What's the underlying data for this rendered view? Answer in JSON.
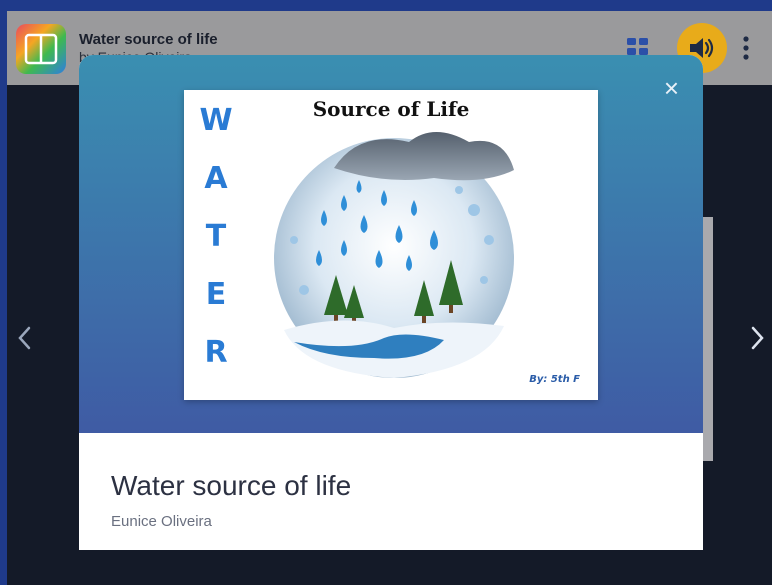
{
  "header": {
    "book_title": "Water source of life",
    "book_author": "by Eunice Oliveira"
  },
  "modal": {
    "close_label": "×",
    "title": "Water source of life",
    "author": "Eunice Oliveira"
  },
  "cover": {
    "vertical_word": [
      "W",
      "A",
      "T",
      "E",
      "R"
    ],
    "heading": "Source of Life",
    "credit": "By: 5th F"
  },
  "navigation": {
    "prev_label": "‹",
    "next_label": "›"
  },
  "icons": {
    "app": "book-creator-app-icon",
    "layout": "grid-view-icon",
    "sound": "speaker-icon",
    "menu": "more-vertical-icon"
  },
  "colors": {
    "frame": "#1f3a8a",
    "background": "#141a28",
    "sound_button": "#e8ab1a",
    "modal_gradient_top": "#3a8fb1",
    "modal_gradient_bottom": "#3f5ba4"
  }
}
